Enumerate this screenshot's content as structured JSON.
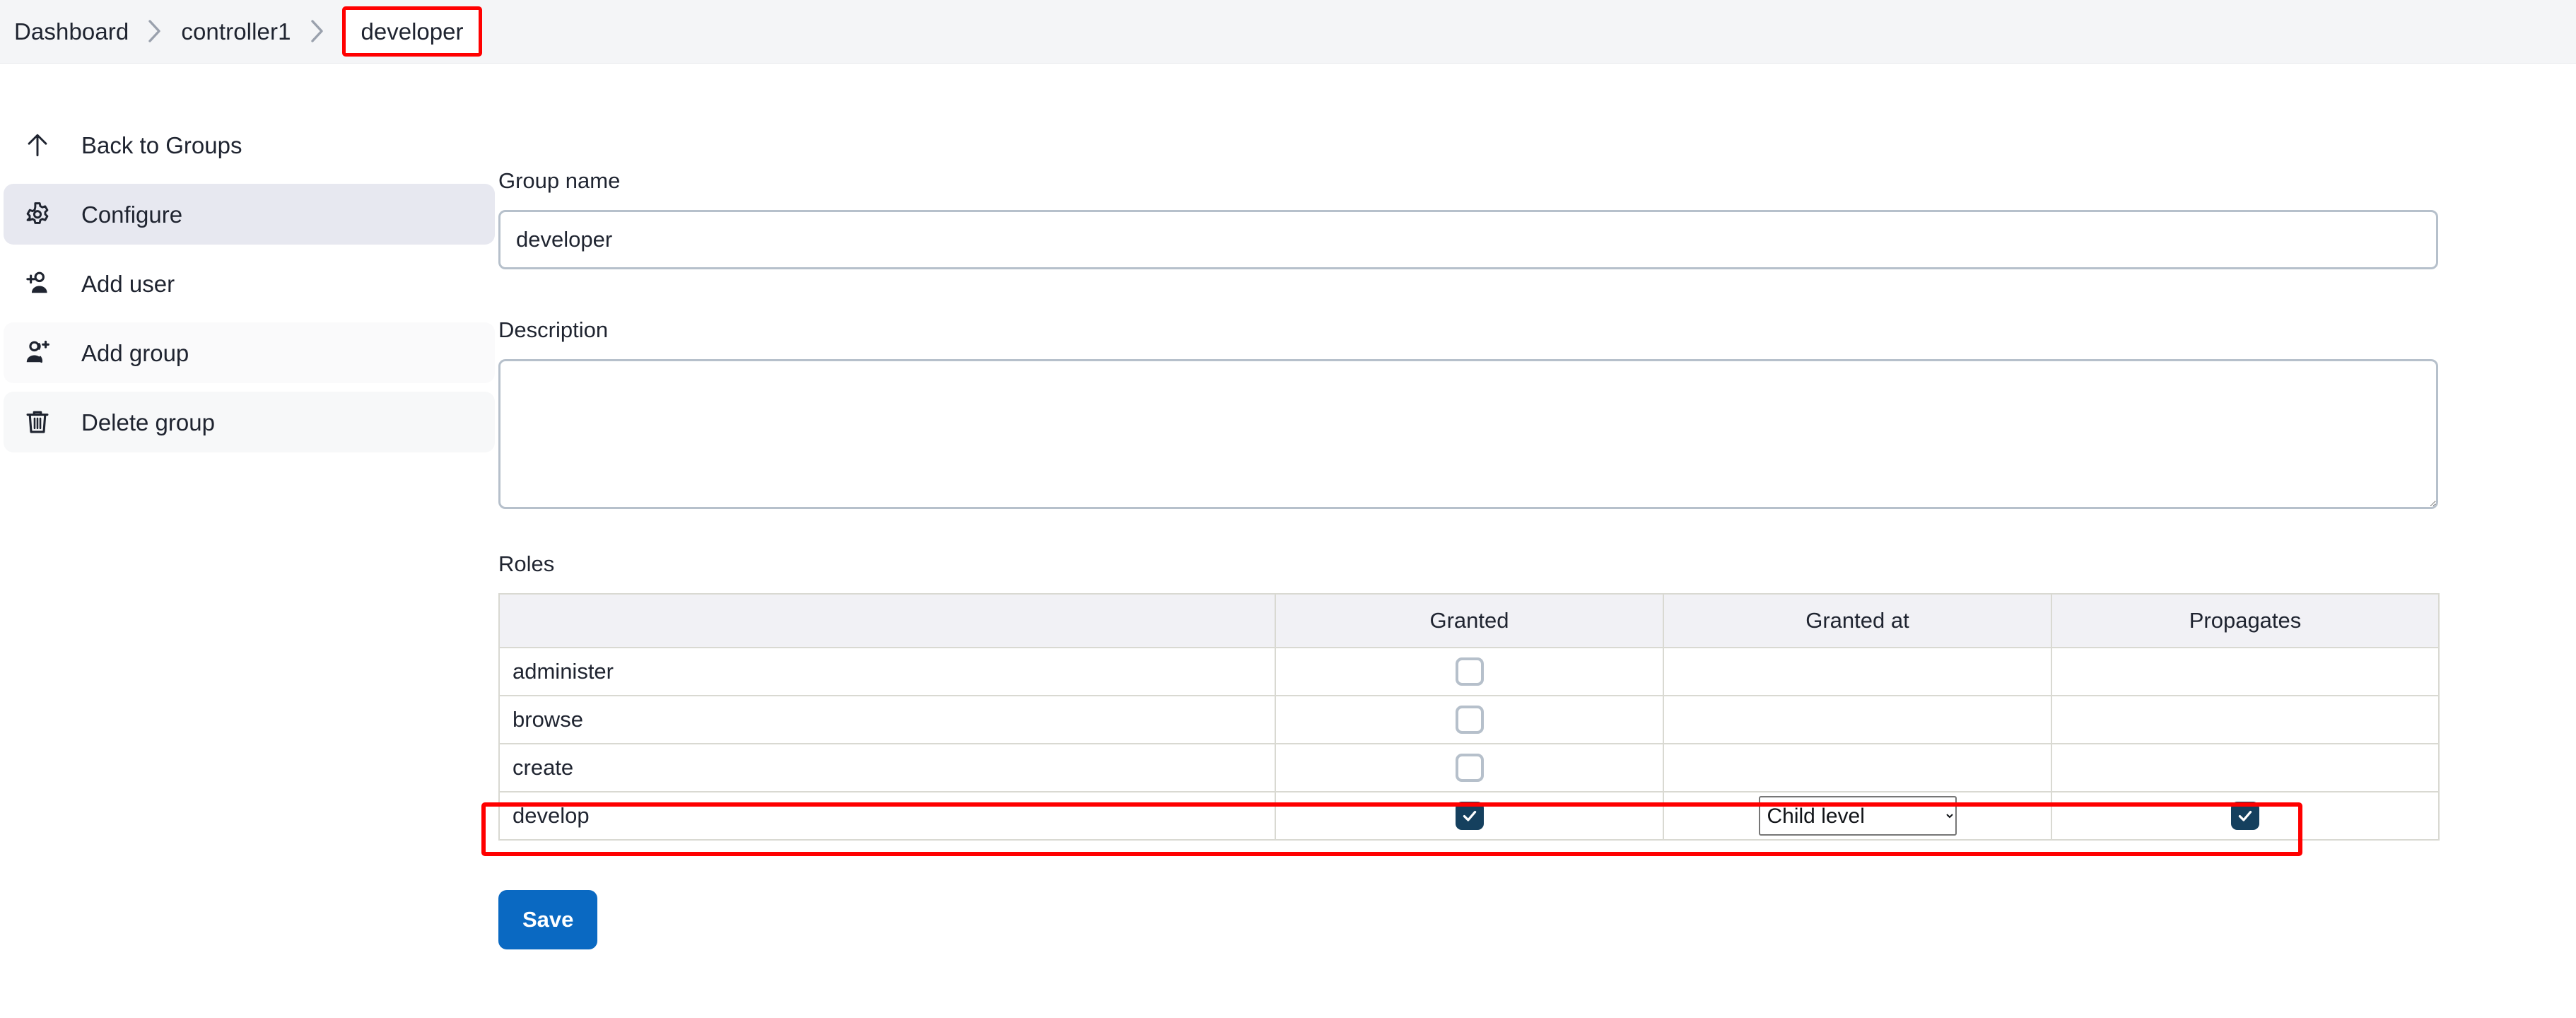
{
  "breadcrumb": {
    "items": [
      {
        "label": "Dashboard",
        "current": false
      },
      {
        "label": "controller1",
        "current": false
      },
      {
        "label": "developer",
        "current": true
      }
    ],
    "separator_icon": "chevron-right-icon",
    "highlight_color": "#ff0000"
  },
  "sidebar": {
    "items": [
      {
        "label": "Back to Groups",
        "icon": "arrow-up-icon",
        "state": "plain"
      },
      {
        "label": "Configure",
        "icon": "gear-icon",
        "state": "selected"
      },
      {
        "label": "Add user",
        "icon": "person-add-icon",
        "state": "plain"
      },
      {
        "label": "Add group",
        "icon": "people-add-icon",
        "state": "tintA"
      },
      {
        "label": "Delete group",
        "icon": "trash-icon",
        "state": "tintB"
      }
    ]
  },
  "main": {
    "group_name": {
      "label": "Group name",
      "value": "developer",
      "placeholder": ""
    },
    "description": {
      "label": "Description",
      "value": "",
      "placeholder": ""
    },
    "roles": {
      "label": "Roles",
      "columns": [
        "",
        "Granted",
        "Granted at",
        "Propagates"
      ],
      "rows": [
        {
          "name": "administer",
          "granted": false,
          "granted_at": "",
          "propagates": null,
          "highlighted": false
        },
        {
          "name": "browse",
          "granted": false,
          "granted_at": "",
          "propagates": null,
          "highlighted": false
        },
        {
          "name": "create",
          "granted": false,
          "granted_at": "",
          "propagates": null,
          "highlighted": false
        },
        {
          "name": "develop",
          "granted": true,
          "granted_at": "Child level",
          "propagates": true,
          "highlighted": true
        }
      ],
      "granted_at_options": [
        "Child level"
      ]
    },
    "save_button": {
      "label": "Save",
      "color": "#0a69c2"
    }
  },
  "colors": {
    "checkbox_checked": "#15405e",
    "checkbox_border": "#b6c0cb",
    "selected_nav": "#e7e8f0",
    "table_header": "#f1f1f5",
    "breadcrumb_bar": "#f4f5f7",
    "highlight": "#ff0000"
  }
}
